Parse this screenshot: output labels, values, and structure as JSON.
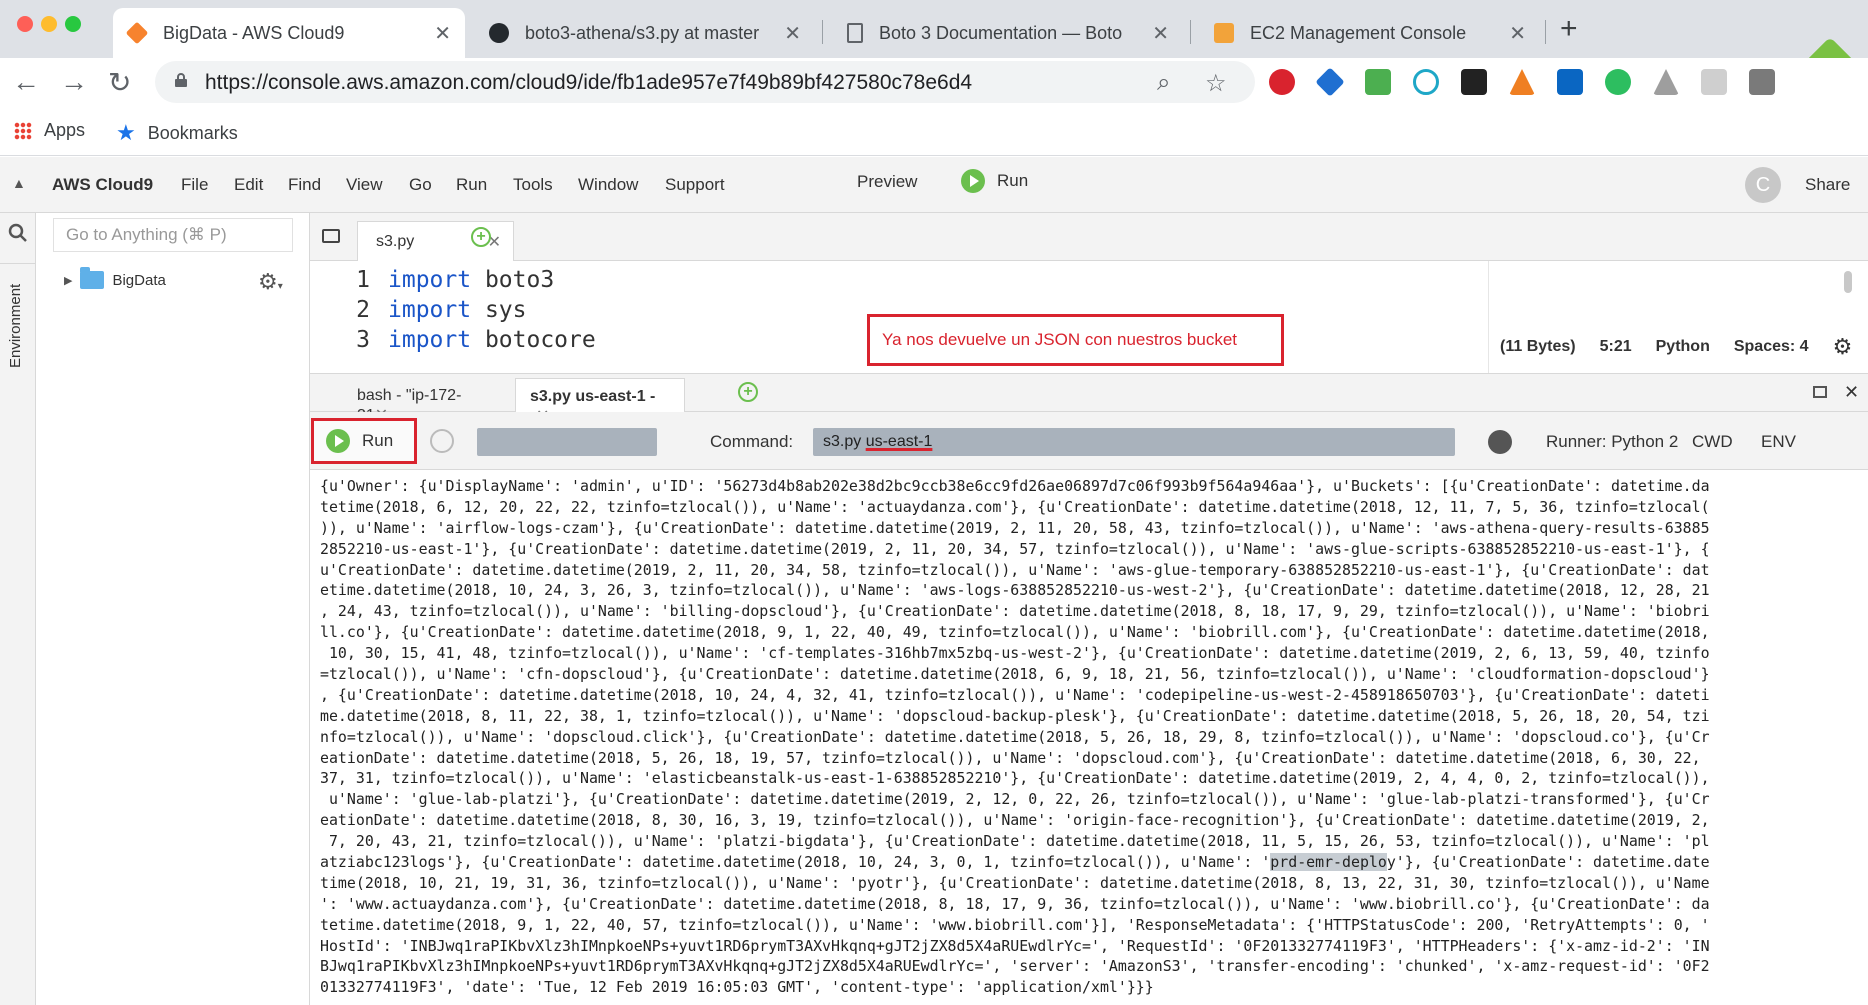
{
  "browser": {
    "tabs": [
      {
        "title": "BigData - AWS Cloud9",
        "favicon": "aws-cloud9-icon",
        "active": true
      },
      {
        "title": "boto3-athena/s3.py at master",
        "favicon": "github-icon",
        "active": false
      },
      {
        "title": "Boto 3 Documentation — Boto",
        "favicon": "document-icon",
        "active": false
      },
      {
        "title": "EC2 Management Console",
        "favicon": "aws-icon",
        "active": false
      }
    ],
    "url": "https://console.aws.amazon.com/cloud9/ide/fb1ade957e7f49b89bf427580c78e6d4",
    "bookmarks": {
      "apps": "Apps",
      "bookmarks": "Bookmarks"
    }
  },
  "ide": {
    "brand": "AWS Cloud9",
    "menu": [
      "File",
      "Edit",
      "Find",
      "View",
      "Go",
      "Run",
      "Tools",
      "Window",
      "Support"
    ],
    "preview": "Preview",
    "run": "Run",
    "share": "Share",
    "avatar_letter": "C",
    "goto_placeholder": "Go to Anything (⌘ P)",
    "environment_label": "Environment",
    "tree_root": "BigData",
    "editor_tab": "s3.py",
    "code": [
      {
        "num": "1",
        "kw": "import",
        "rest": " boto3"
      },
      {
        "num": "2",
        "kw": "import",
        "rest": " sys"
      },
      {
        "num": "3",
        "kw": "import",
        "rest": " botocore"
      }
    ],
    "status": {
      "size": "(11 Bytes)",
      "pos": "5:21",
      "lang": "Python",
      "spaces": "Spaces: 4"
    },
    "annotation": "Ya nos devuelve un JSON con nuestros bucket",
    "terminal_tabs": [
      {
        "label": "bash - \"ip-172-31"
      },
      {
        "label": "s3.py us-east-1 -"
      }
    ],
    "runner": {
      "run": "Run",
      "command_label": "Command:",
      "command_prefix": "s3.py ",
      "command_arg": "us-east-1",
      "runner": "Runner: Python 2",
      "cwd": "CWD",
      "env": "ENV"
    },
    "output_lines": [
      "{u'Owner': {u'DisplayName': 'admin', u'ID': '56273d4b8ab202e38d2bc9ccb38e6cc9fd26ae06897d7c06f993b9f564a946aa'}, u'Buckets': [{u'CreationDate': datetime.da",
      "tetime(2018, 6, 12, 20, 22, 22, tzinfo=tzlocal()), u'Name': 'actuaydanza.com'}, {u'CreationDate': datetime.datetime(2018, 12, 11, 7, 5, 36, tzinfo=tzlocal(",
      ")), u'Name': 'airflow-logs-czam'}, {u'CreationDate': datetime.datetime(2019, 2, 11, 20, 58, 43, tzinfo=tzlocal()), u'Name': 'aws-athena-query-results-63885",
      "2852210-us-east-1'}, {u'CreationDate': datetime.datetime(2019, 2, 11, 20, 34, 57, tzinfo=tzlocal()), u'Name': 'aws-glue-scripts-638852852210-us-east-1'}, {",
      "u'CreationDate': datetime.datetime(2019, 2, 11, 20, 34, 58, tzinfo=tzlocal()), u'Name': 'aws-glue-temporary-638852852210-us-east-1'}, {u'CreationDate': dat",
      "etime.datetime(2018, 10, 24, 3, 26, 3, tzinfo=tzlocal()), u'Name': 'aws-logs-638852852210-us-west-2'}, {u'CreationDate': datetime.datetime(2018, 12, 28, 21",
      ", 24, 43, tzinfo=tzlocal()), u'Name': 'billing-dopscloud'}, {u'CreationDate': datetime.datetime(2018, 8, 18, 17, 9, 29, tzinfo=tzlocal()), u'Name': 'biobri",
      "ll.co'}, {u'CreationDate': datetime.datetime(2018, 9, 1, 22, 40, 49, tzinfo=tzlocal()), u'Name': 'biobrill.com'}, {u'CreationDate': datetime.datetime(2018,",
      " 10, 30, 15, 41, 48, tzinfo=tzlocal()), u'Name': 'cf-templates-316hb7mx5zbq-us-west-2'}, {u'CreationDate': datetime.datetime(2019, 2, 6, 13, 59, 40, tzinfo",
      "=tzlocal()), u'Name': 'cfn-dopscloud'}, {u'CreationDate': datetime.datetime(2018, 6, 9, 18, 21, 56, tzinfo=tzlocal()), u'Name': 'cloudformation-dopscloud'}",
      ", {u'CreationDate': datetime.datetime(2018, 10, 24, 4, 32, 41, tzinfo=tzlocal()), u'Name': 'codepipeline-us-west-2-458918650703'}, {u'CreationDate': dateti",
      "me.datetime(2018, 8, 11, 22, 38, 1, tzinfo=tzlocal()), u'Name': 'dopscloud-backup-plesk'}, {u'CreationDate': datetime.datetime(2018, 5, 26, 18, 20, 54, tzi",
      "nfo=tzlocal()), u'Name': 'dopscloud.click'}, {u'CreationDate': datetime.datetime(2018, 5, 26, 18, 29, 8, tzinfo=tzlocal()), u'Name': 'dopscloud.co'}, {u'Cr",
      "eationDate': datetime.datetime(2018, 5, 26, 18, 19, 57, tzinfo=tzlocal()), u'Name': 'dopscloud.com'}, {u'CreationDate': datetime.datetime(2018, 6, 30, 22,",
      "37, 31, tzinfo=tzlocal()), u'Name': 'elasticbeanstalk-us-east-1-638852852210'}, {u'CreationDate': datetime.datetime(2019, 2, 4, 4, 0, 2, tzinfo=tzlocal()),",
      " u'Name': 'glue-lab-platzi'}, {u'CreationDate': datetime.datetime(2019, 2, 12, 0, 22, 26, tzinfo=tzlocal()), u'Name': 'glue-lab-platzi-transformed'}, {u'Cr",
      "eationDate': datetime.datetime(2018, 8, 30, 16, 3, 19, tzinfo=tzlocal()), u'Name': 'origin-face-recognition'}, {u'CreationDate': datetime.datetime(2019, 2,",
      " 7, 20, 43, 21, tzinfo=tzlocal()), u'Name': 'platzi-bigdata'}, {u'CreationDate': datetime.datetime(2018, 11, 5, 15, 26, 53, tzinfo=tzlocal()), u'Name': 'pl",
      "atziabc123logs'}, {u'CreationDate': datetime.datetime(2018, 10, 24, 3, 0, 1, tzinfo=tzlocal()), u'Name': '§prd-emr-deplo§y'}, {u'CreationDate': datetime.date",
      "time(2018, 10, 21, 19, 31, 36, tzinfo=tzlocal()), u'Name': 'pyotr'}, {u'CreationDate': datetime.datetime(2018, 8, 13, 22, 31, 30, tzinfo=tzlocal()), u'Name",
      "': 'www.actuaydanza.com'}, {u'CreationDate': datetime.datetime(2018, 8, 18, 17, 9, 36, tzinfo=tzlocal()), u'Name': 'www.biobrill.co'}, {u'CreationDate': da",
      "tetime.datetime(2018, 9, 1, 22, 40, 57, tzinfo=tzlocal()), u'Name': 'www.biobrill.com'}], 'ResponseMetadata': {'HTTPStatusCode': 200, 'RetryAttempts': 0, '",
      "HostId': 'INBJwq1raPIKbvXlz3hIMnpkoeNPs+yuvt1RD6prymT3AXvHkqnq+gJT2jZX8d5X4aRUEwdlrYc=', 'RequestId': '0F201332774119F3', 'HTTPHeaders': {'x-amz-id-2': 'IN",
      "BJwq1raPIKbvXlz3hIMnpkoeNPs+yuvt1RD6prymT3AXvHkqnq+gJT2jZX8d5X4aRUEwdlrYc=', 'server': 'AmazonS3', 'transfer-encoding': 'chunked', 'x-amz-request-id': '0F2",
      "01332774119F3', 'date': 'Tue, 12 Feb 2019 16:05:03 GMT', 'content-type': 'application/xml'}}}"
    ]
  }
}
